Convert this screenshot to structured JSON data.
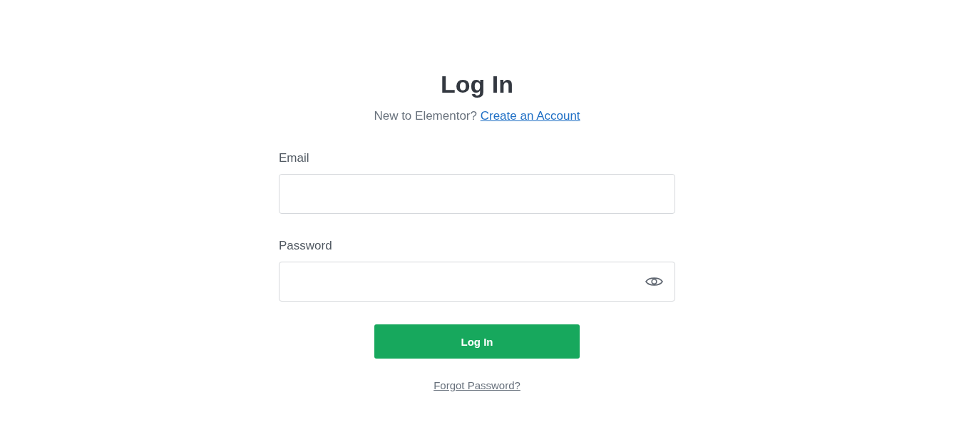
{
  "heading": "Log In",
  "signup_prompt": {
    "text": "New to Elementor?",
    "link": "Create an Account"
  },
  "fields": [
    {
      "label": "Email",
      "kind": "text"
    },
    {
      "label": "Password",
      "kind": "password"
    }
  ],
  "submit_button": "Log In",
  "forgot_link": "Forgot Password?"
}
